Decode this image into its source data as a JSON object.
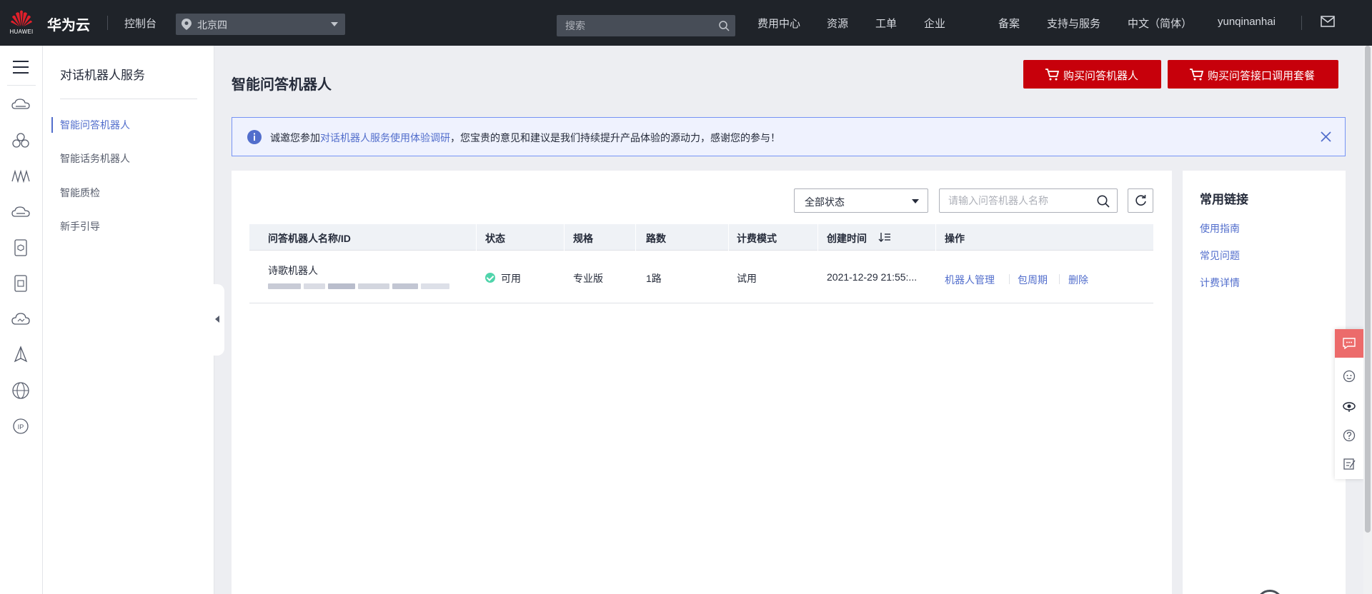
{
  "topbar": {
    "logo_text": "HUAWEI",
    "brand": "华为云",
    "console": "控制台",
    "region": "北京四",
    "search_placeholder": "搜索",
    "links": [
      "费用中心",
      "资源",
      "工单",
      "企业",
      "备案",
      "支持与服务",
      "中文（简体）",
      "yunqinanhai"
    ]
  },
  "rail_icons": [
    "menu-icon",
    "cloud-server-icon",
    "cluster-icon",
    "waveform-icon",
    "cloud-disk-icon",
    "cube-icon",
    "database-icon",
    "cloud-icon",
    "tower-icon",
    "globe-icon",
    "ip-icon"
  ],
  "side_nav": {
    "title": "对话机器人服务",
    "items": [
      {
        "label": "智能问答机器人",
        "active": true
      },
      {
        "label": "智能话务机器人",
        "active": false
      },
      {
        "label": "智能质检",
        "active": false
      },
      {
        "label": "新手引导",
        "active": false
      }
    ]
  },
  "main": {
    "title": "智能问答机器人",
    "buy_robot": "购买问答机器人",
    "buy_package": "购买问答接口调用套餐"
  },
  "notice": {
    "prefix": "诚邀您参加",
    "link": "对话机器人服务使用体验调研",
    "suffix": "，您宝贵的意见和建议是我们持续提升产品体验的源动力，感谢您的参与！"
  },
  "filters": {
    "status": "全部状态",
    "search_placeholder": "请输入问答机器人名称"
  },
  "table": {
    "headers": [
      "问答机器人名称/ID",
      "状态",
      "规格",
      "路数",
      "计费模式",
      "创建时间",
      "操作"
    ],
    "rows": [
      {
        "name": "诗歌机器人",
        "status": "可用",
        "spec": "专业版",
        "lines": "1路",
        "billing": "试用",
        "created": "2021-12-29 21:55:...",
        "actions": [
          "机器人管理",
          "包周期",
          "删除"
        ]
      }
    ]
  },
  "common_links": {
    "title": "常用链接",
    "items": [
      "使用指南",
      "常见问题",
      "计费详情"
    ]
  },
  "colors": {
    "topbar": "#1f2329",
    "brand_red": "#c7000b",
    "link_blue": "#526ecc",
    "status_green": "#50d4ab"
  }
}
